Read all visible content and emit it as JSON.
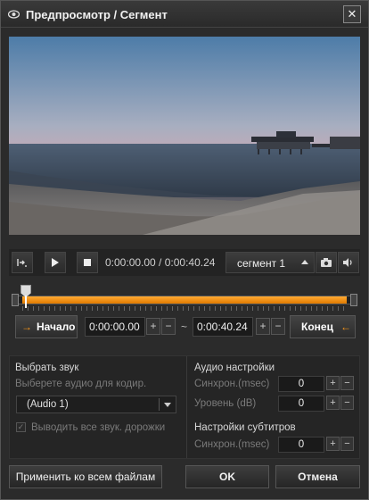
{
  "window": {
    "title": "Предпросмотр / Сегмент",
    "close_symbol": "✕"
  },
  "video": {
    "description": ""
  },
  "transport": {
    "time_display": "0:00:00.00 / 0:00:40.24",
    "segment_label": "сегмент 1",
    "icons": [
      "step-frame-icon",
      "play-icon",
      "stop-icon",
      "camera-icon",
      "speaker-icon"
    ]
  },
  "timeline": {
    "position_fraction": 0.0
  },
  "range": {
    "start_label": "Начало",
    "end_label": "Конец",
    "start_time": "0:00:00.00",
    "end_time": "0:00:40.24",
    "tilde": "~",
    "plus": "+",
    "minus": "−"
  },
  "audio": {
    "heading": "Выбрать звук",
    "hint": "Выберете аудио для кодир.",
    "selected": "(Audio 1)",
    "all_tracks_label": "Выводить все звук. дорожки",
    "all_tracks_checked": true
  },
  "audio_settings": {
    "heading": "Аудио настройки",
    "sync_label": "Синхрон.(msec)",
    "sync_value": "0",
    "level_label": "Уровень (dB)",
    "level_value": "0"
  },
  "subtitle_settings": {
    "heading": "Настройки субтитров",
    "sync_label": "Синхрон.(msec)",
    "sync_value": "0"
  },
  "footer": {
    "apply_all_label": "Применить ко всем файлам",
    "ok_label": "OK",
    "cancel_label": "Отмена"
  },
  "colors": {
    "accent": "#f08a10",
    "background": "#2b2b2b"
  }
}
